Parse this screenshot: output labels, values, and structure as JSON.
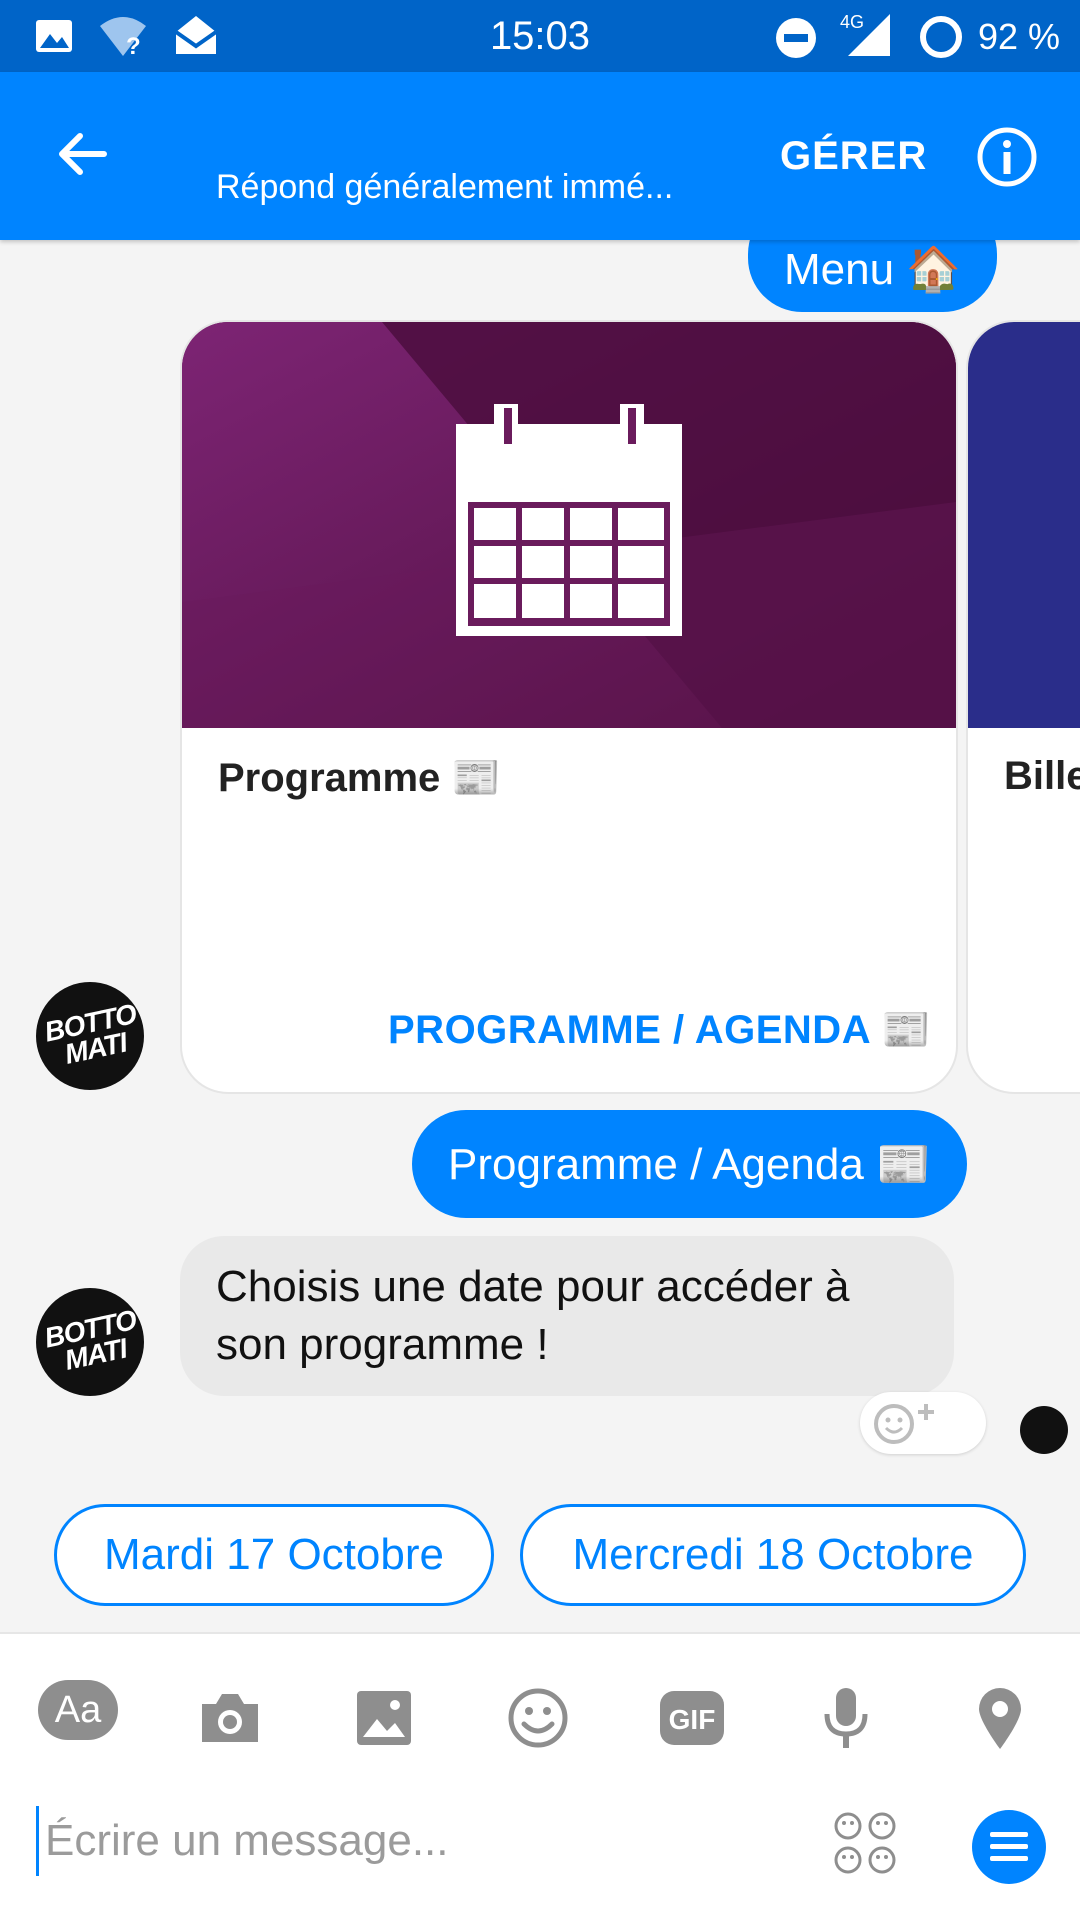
{
  "status_bar": {
    "time": "15:03",
    "battery": "92 %",
    "network": "4G"
  },
  "header": {
    "subtitle": "Répond généralement immé...",
    "manage_label": "GÉRER"
  },
  "messages": {
    "menu_reply": "Menu 🏠",
    "card_title": "Programme 📰",
    "card_action": "PROGRAMME / AGENDA 📰",
    "next_card_title": "Bille",
    "user_reply": "Programme / Agenda 📰",
    "bot_text": "Choisis une date pour accéder à son programme !"
  },
  "avatar": {
    "text": "BOTTO MATI"
  },
  "quick_replies": [
    "Mardi 17 Octobre",
    "Mercredi 18 Octobre"
  ],
  "composer": {
    "aa_label": "Aa",
    "gif_label": "GIF",
    "placeholder": "Écrire un message..."
  },
  "colors": {
    "accent": "#0084ff",
    "status_bar": "#0064c8",
    "card_image": "#5a1148"
  },
  "icons": [
    "image-icon",
    "wifi-icon",
    "mail-icon",
    "dnd-icon",
    "signal-icon",
    "battery-icon",
    "back-arrow-icon",
    "info-icon",
    "calendar-icon",
    "smiley-plus-icon",
    "camera-icon",
    "gallery-icon",
    "emoji-icon",
    "microphone-icon",
    "location-icon",
    "emoji-grid-icon",
    "menu-icon"
  ]
}
